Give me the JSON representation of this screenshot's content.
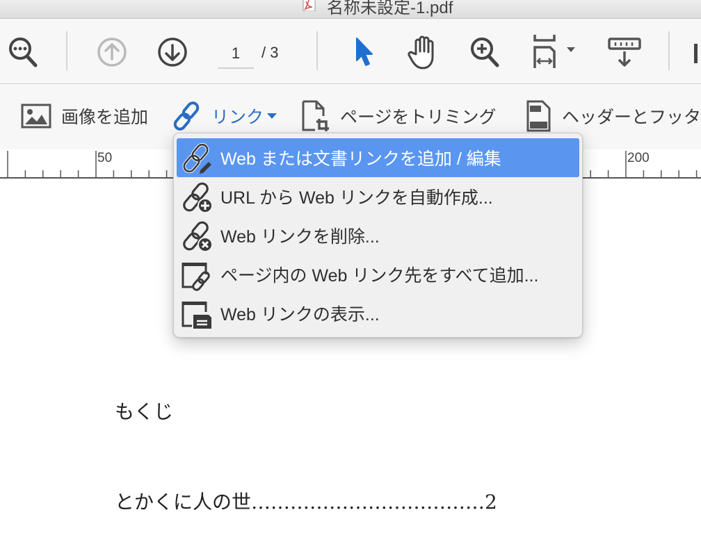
{
  "window": {
    "title": "名称未設定-1.pdf",
    "file_icon": "pdf-file-icon"
  },
  "toolbar": {
    "find_icon": "search-more-icon",
    "prev_page_icon": "arrow-up-circle-icon",
    "next_page_icon": "arrow-down-circle-icon",
    "page_current": "1",
    "page_total": "/ 3",
    "select_tool_icon": "pointer-arrow-icon",
    "hand_tool_icon": "hand-icon",
    "zoom_in_icon": "zoom-in-icon",
    "fit_page_icon": "fit-width-icon",
    "scroll_mode_icon": "scroll-mode-icon"
  },
  "edit_toolbar": {
    "add_image": "画像を追加",
    "link": "リンク",
    "crop_pages": "ページをトリミング",
    "header_footer": "ヘッダーとフッタ"
  },
  "ruler": {
    "labels": [
      "50",
      "200"
    ]
  },
  "link_menu": {
    "items": [
      {
        "label": "Web または文書リンクを追加 / 編集",
        "icon": "link-edit-icon",
        "active": true
      },
      {
        "label": "URL から Web リンクを自動作成...",
        "icon": "link-add-icon",
        "active": false
      },
      {
        "label": "Web リンクを削除...",
        "icon": "link-remove-icon",
        "active": false
      },
      {
        "label": "ページ内の Web リンク先をすべて追加...",
        "icon": "page-link-icon",
        "active": false
      },
      {
        "label": "Web リンクの表示...",
        "icon": "show-links-icon",
        "active": false
      }
    ]
  },
  "document": {
    "toc_heading": "もくじ",
    "toc_entry_1": "とかくに人の世………………………………2"
  },
  "colors": {
    "accent_blue": "#2a6ec4",
    "menu_highlight": "#5a96f0",
    "pdf_red": "#d9534f"
  }
}
